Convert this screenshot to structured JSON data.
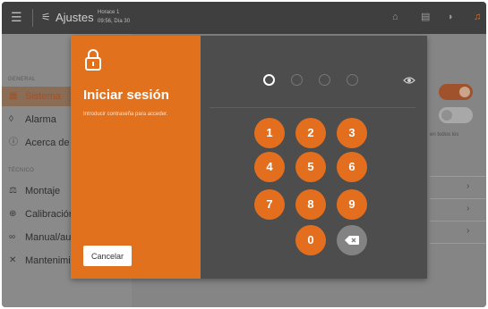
{
  "topbar": {
    "title": "Ajustes",
    "room": "Horace 1",
    "datetime": "09:56, Día 30",
    "icons": [
      "menu-icon",
      "sliders-icon",
      "home-icon",
      "document-icon",
      "wifi-icon",
      "bell-icon"
    ]
  },
  "sidebar": {
    "section_general": "GENERAL",
    "section_tecnico": "TÉCNICO",
    "items": [
      {
        "label": "Sistema",
        "icon": "grid-icon",
        "active": true
      },
      {
        "label": "Alarma",
        "icon": "bell-icon",
        "active": false
      },
      {
        "label": "Acerca de",
        "icon": "info-icon",
        "active": false
      },
      {
        "label": "Montaje",
        "icon": "mount-icon",
        "active": false
      },
      {
        "label": "Calibración",
        "icon": "target-icon",
        "active": false
      },
      {
        "label": "Manual/au",
        "icon": "link-icon",
        "active": false
      },
      {
        "label": "Mantenimi",
        "icon": "tools-icon",
        "active": false
      }
    ]
  },
  "content": {
    "hint_text": "en todos los"
  },
  "modal": {
    "title": "Iniciar sesión",
    "description": "Introducir contraseña para acceder.",
    "cancel_label": "Cancelar",
    "pin_length": 4,
    "pin_entered": 1,
    "keys": [
      "1",
      "2",
      "3",
      "4",
      "5",
      "6",
      "7",
      "8",
      "9",
      "0"
    ],
    "accent": "#e2711d"
  }
}
